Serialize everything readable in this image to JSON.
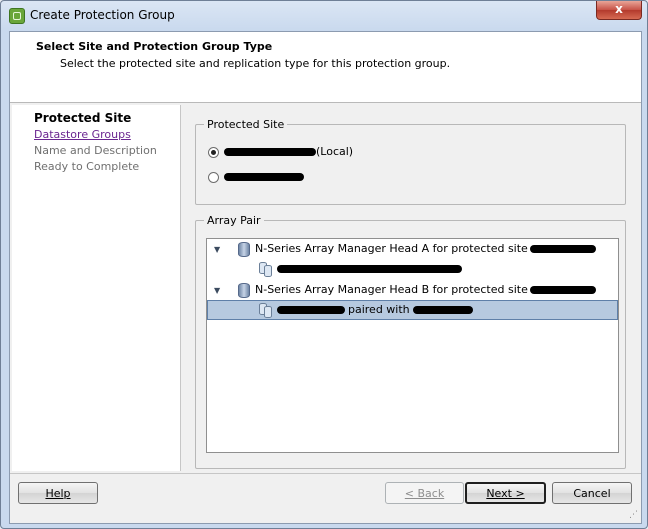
{
  "window": {
    "title": "Create Protection Group",
    "close_glyph": "x"
  },
  "header": {
    "title": "Select Site and Protection Group Type",
    "subtitle": "Select the protected site and replication type for this protection group."
  },
  "nav": {
    "items": [
      {
        "label": "Protected Site",
        "state": "current"
      },
      {
        "label": "Datastore Groups",
        "state": "link"
      },
      {
        "label": "Name and Description",
        "state": "disabled"
      },
      {
        "label": "Ready to Complete",
        "state": "disabled"
      }
    ]
  },
  "protected_site": {
    "label": "Protected Site",
    "options": [
      {
        "text": "(Local)",
        "checked": true
      },
      {
        "text": "",
        "checked": false
      }
    ]
  },
  "array_pair": {
    "label": "Array Pair",
    "rows": [
      {
        "text": "N-Series Array Manager Head A for protected site",
        "type": "array",
        "expanded": true
      },
      {
        "text": "",
        "type": "pair",
        "selected": false
      },
      {
        "text": "N-Series Array Manager Head B for protected site",
        "type": "array",
        "expanded": true
      },
      {
        "text": "paired with",
        "type": "pair",
        "selected": true
      }
    ]
  },
  "buttons": {
    "help": "Help",
    "back": "< Back",
    "next": "Next >",
    "cancel": "Cancel"
  },
  "colors": {
    "selection": "#b6c9df",
    "link": "#6a2590",
    "title_bar": "#c9d9ee"
  },
  "icons": {
    "app": "protection-group-app-icon",
    "expander": "chevron-down-icon",
    "array": "database-icon",
    "pair": "volume-pair-icon"
  }
}
